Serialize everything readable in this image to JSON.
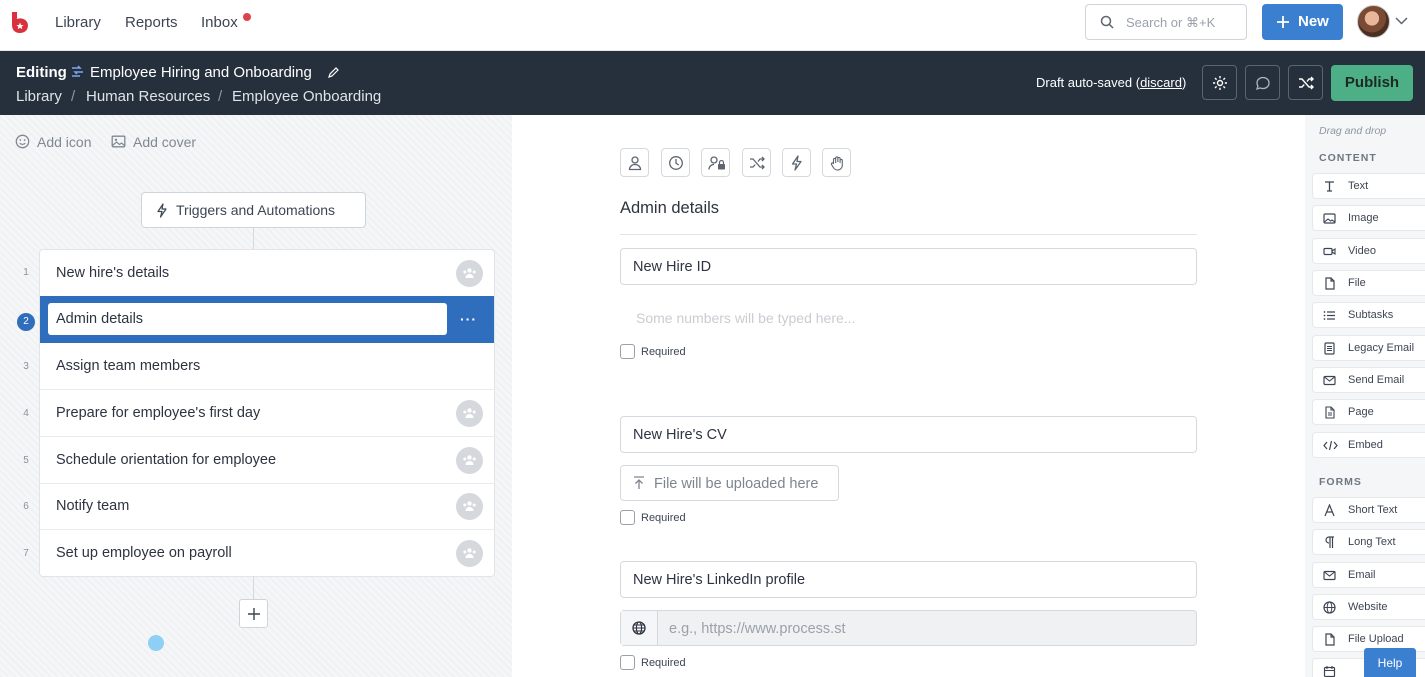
{
  "topnav": {
    "links": [
      "Library",
      "Reports",
      "Inbox"
    ],
    "search_placeholder": "Search or ⌘+K",
    "new_label": "New"
  },
  "editbar": {
    "mode": "Editing",
    "template_title": "Employee Hiring and Onboarding",
    "breadcrumb": [
      "Library",
      "Human Resources",
      "Employee Onboarding"
    ],
    "breadcrumb_sep": "/",
    "draft_text": "Draft auto-saved",
    "discard": "discard",
    "publish": "Publish"
  },
  "leftpane": {
    "add_icon": "Add icon",
    "add_cover": "Add cover",
    "triggers": "Triggers and Automations",
    "tasks": [
      {
        "num": "1",
        "label": "New hire's details",
        "assignee_icon": "people-icon"
      },
      {
        "num": "2",
        "label": "Admin details",
        "selected": true
      },
      {
        "num": "3",
        "label": "Assign team members"
      },
      {
        "num": "4",
        "label": "Prepare for employee's first day",
        "assignee_icon": "people-icon"
      },
      {
        "num": "5",
        "label": "Schedule orientation for employee",
        "assignee_icon": "people-icon"
      },
      {
        "num": "6",
        "label": "Notify team",
        "assignee_icon": "people-icon"
      },
      {
        "num": "7",
        "label": "Set up employee on payroll",
        "assignee_icon": "people-icon"
      }
    ],
    "more_dots": "···"
  },
  "main": {
    "toolbar_icons": [
      "assignee-icon",
      "clock-icon",
      "permissions-icon",
      "conditional-logic-icon",
      "automation-icon",
      "stop-icon"
    ],
    "section_title": "Admin details",
    "fields": [
      {
        "label": "New Hire ID",
        "placeholder": "Some numbers will be typed here...",
        "required_label": "Required"
      },
      {
        "label": "New Hire's CV",
        "placeholder": "File will be uploaded here",
        "required_label": "Required"
      },
      {
        "label": "New Hire's LinkedIn profile",
        "placeholder": "e.g., https://www.process.st",
        "required_label": "Required"
      }
    ]
  },
  "rightpane": {
    "hint": "Drag and drop",
    "content_label": "CONTENT",
    "content_items": [
      "Text",
      "Image",
      "Video",
      "File",
      "Subtasks",
      "Legacy Email",
      "Send Email",
      "Page",
      "Embed"
    ],
    "forms_label": "FORMS",
    "form_items": [
      "Short Text",
      "Long Text",
      "Email",
      "Website",
      "File Upload"
    ]
  },
  "help": "Help",
  "colors": {
    "accent": "#3a7fd0",
    "editbar": "#25303c",
    "publish": "#4caf85",
    "selected_task": "#2f6dbd",
    "notification": "#e0424d"
  }
}
